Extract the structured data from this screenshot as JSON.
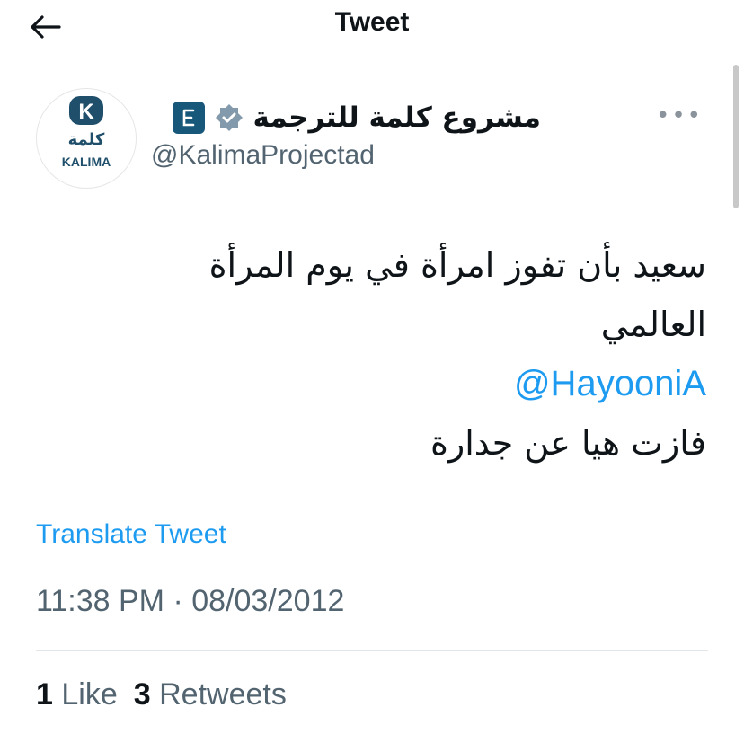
{
  "header": {
    "title": "Tweet",
    "back_icon": "arrow-left-icon"
  },
  "author": {
    "display_name": "مشروع كلمة للترجمة",
    "handle": "@KalimaProjectad",
    "avatar_logo_text": "KALIMA",
    "verified_icon": "verified-badge-icon",
    "gov_badge_icon": "government-badge-icon",
    "badge_color": "#17577a"
  },
  "more_icon": "more-dots-icon",
  "tweet": {
    "lines": [
      "سعيد بأن تفوز امرأة في يوم المرأة",
      "العالمي"
    ],
    "mention": "@HayooniA",
    "last_line": "فازت هيا عن جدارة"
  },
  "translate_label": "Translate Tweet",
  "timestamp": "11:38 PM · 08/03/2012",
  "stats": {
    "likes_count": "1",
    "likes_label": "Like",
    "retweets_count": "3",
    "retweets_label": "Retweets"
  },
  "colors": {
    "accent": "#1d9bf0",
    "text": "#0f1419",
    "muted": "#536471"
  }
}
